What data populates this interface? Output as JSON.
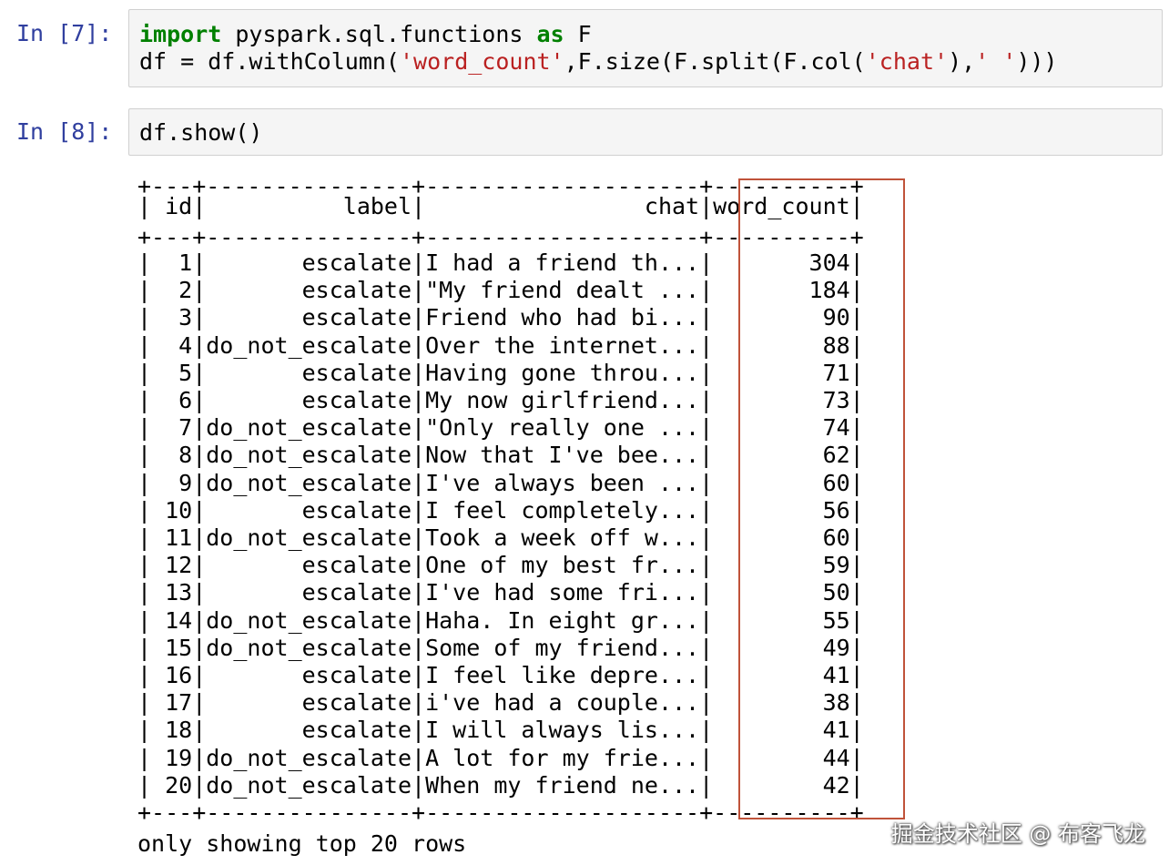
{
  "cells": [
    {
      "prompt": "In [7]:",
      "lines": [
        [
          {
            "t": "import",
            "k": "kw"
          },
          {
            "t": " pyspark.sql.functions ",
            "k": ""
          },
          {
            "t": "as",
            "k": "kw"
          },
          {
            "t": " F",
            "k": ""
          }
        ],
        [
          {
            "t": "df = df.withColumn(",
            "k": ""
          },
          {
            "t": "'word_count'",
            "k": "str"
          },
          {
            "t": ",F.size(F.split(F.col(",
            "k": ""
          },
          {
            "t": "'chat'",
            "k": "str"
          },
          {
            "t": "),",
            "k": ""
          },
          {
            "t": "' '",
            "k": "str"
          },
          {
            "t": ")))",
            "k": ""
          }
        ]
      ]
    },
    {
      "prompt": "In [8]:",
      "lines": [
        [
          {
            "t": "df.show()",
            "k": ""
          }
        ]
      ]
    }
  ],
  "output": {
    "border": "+---+---------------+--------------------+----------+",
    "header": "| id|          label|                chat|word_count|",
    "rows": [
      "|  1|       escalate|I had a friend th...|       304|",
      "|  2|       escalate|\"My friend dealt ...|       184|",
      "|  3|       escalate|Friend who had bi...|        90|",
      "|  4|do_not_escalate|Over the internet...|        88|",
      "|  5|       escalate|Having gone throu...|        71|",
      "|  6|       escalate|My now girlfriend...|        73|",
      "|  7|do_not_escalate|\"Only really one ...|        74|",
      "|  8|do_not_escalate|Now that I've bee...|        62|",
      "|  9|do_not_escalate|I've always been ...|        60|",
      "| 10|       escalate|I feel completely...|        56|",
      "| 11|do_not_escalate|Took a week off w...|        60|",
      "| 12|       escalate|One of my best fr...|        59|",
      "| 13|       escalate|I've had some fri...|        50|",
      "| 14|do_not_escalate|Haha. In eight gr...|        55|",
      "| 15|do_not_escalate|Some of my friend...|        49|",
      "| 16|       escalate|I feel like depre...|        41|",
      "| 17|       escalate|i've had a couple...|        38|",
      "| 18|       escalate|I will always lis...|        41|",
      "| 19|do_not_escalate|A lot for my frie...|        44|",
      "| 20|do_not_escalate|When my friend ne...|        42|"
    ],
    "footer": "only showing top 20 rows"
  },
  "watermark": "掘金技术社区 @ 布客飞龙",
  "colors": {
    "prompt": "#303F9F",
    "keyword": "#008000",
    "string": "#BA2121",
    "highlight": "#c0533a"
  }
}
